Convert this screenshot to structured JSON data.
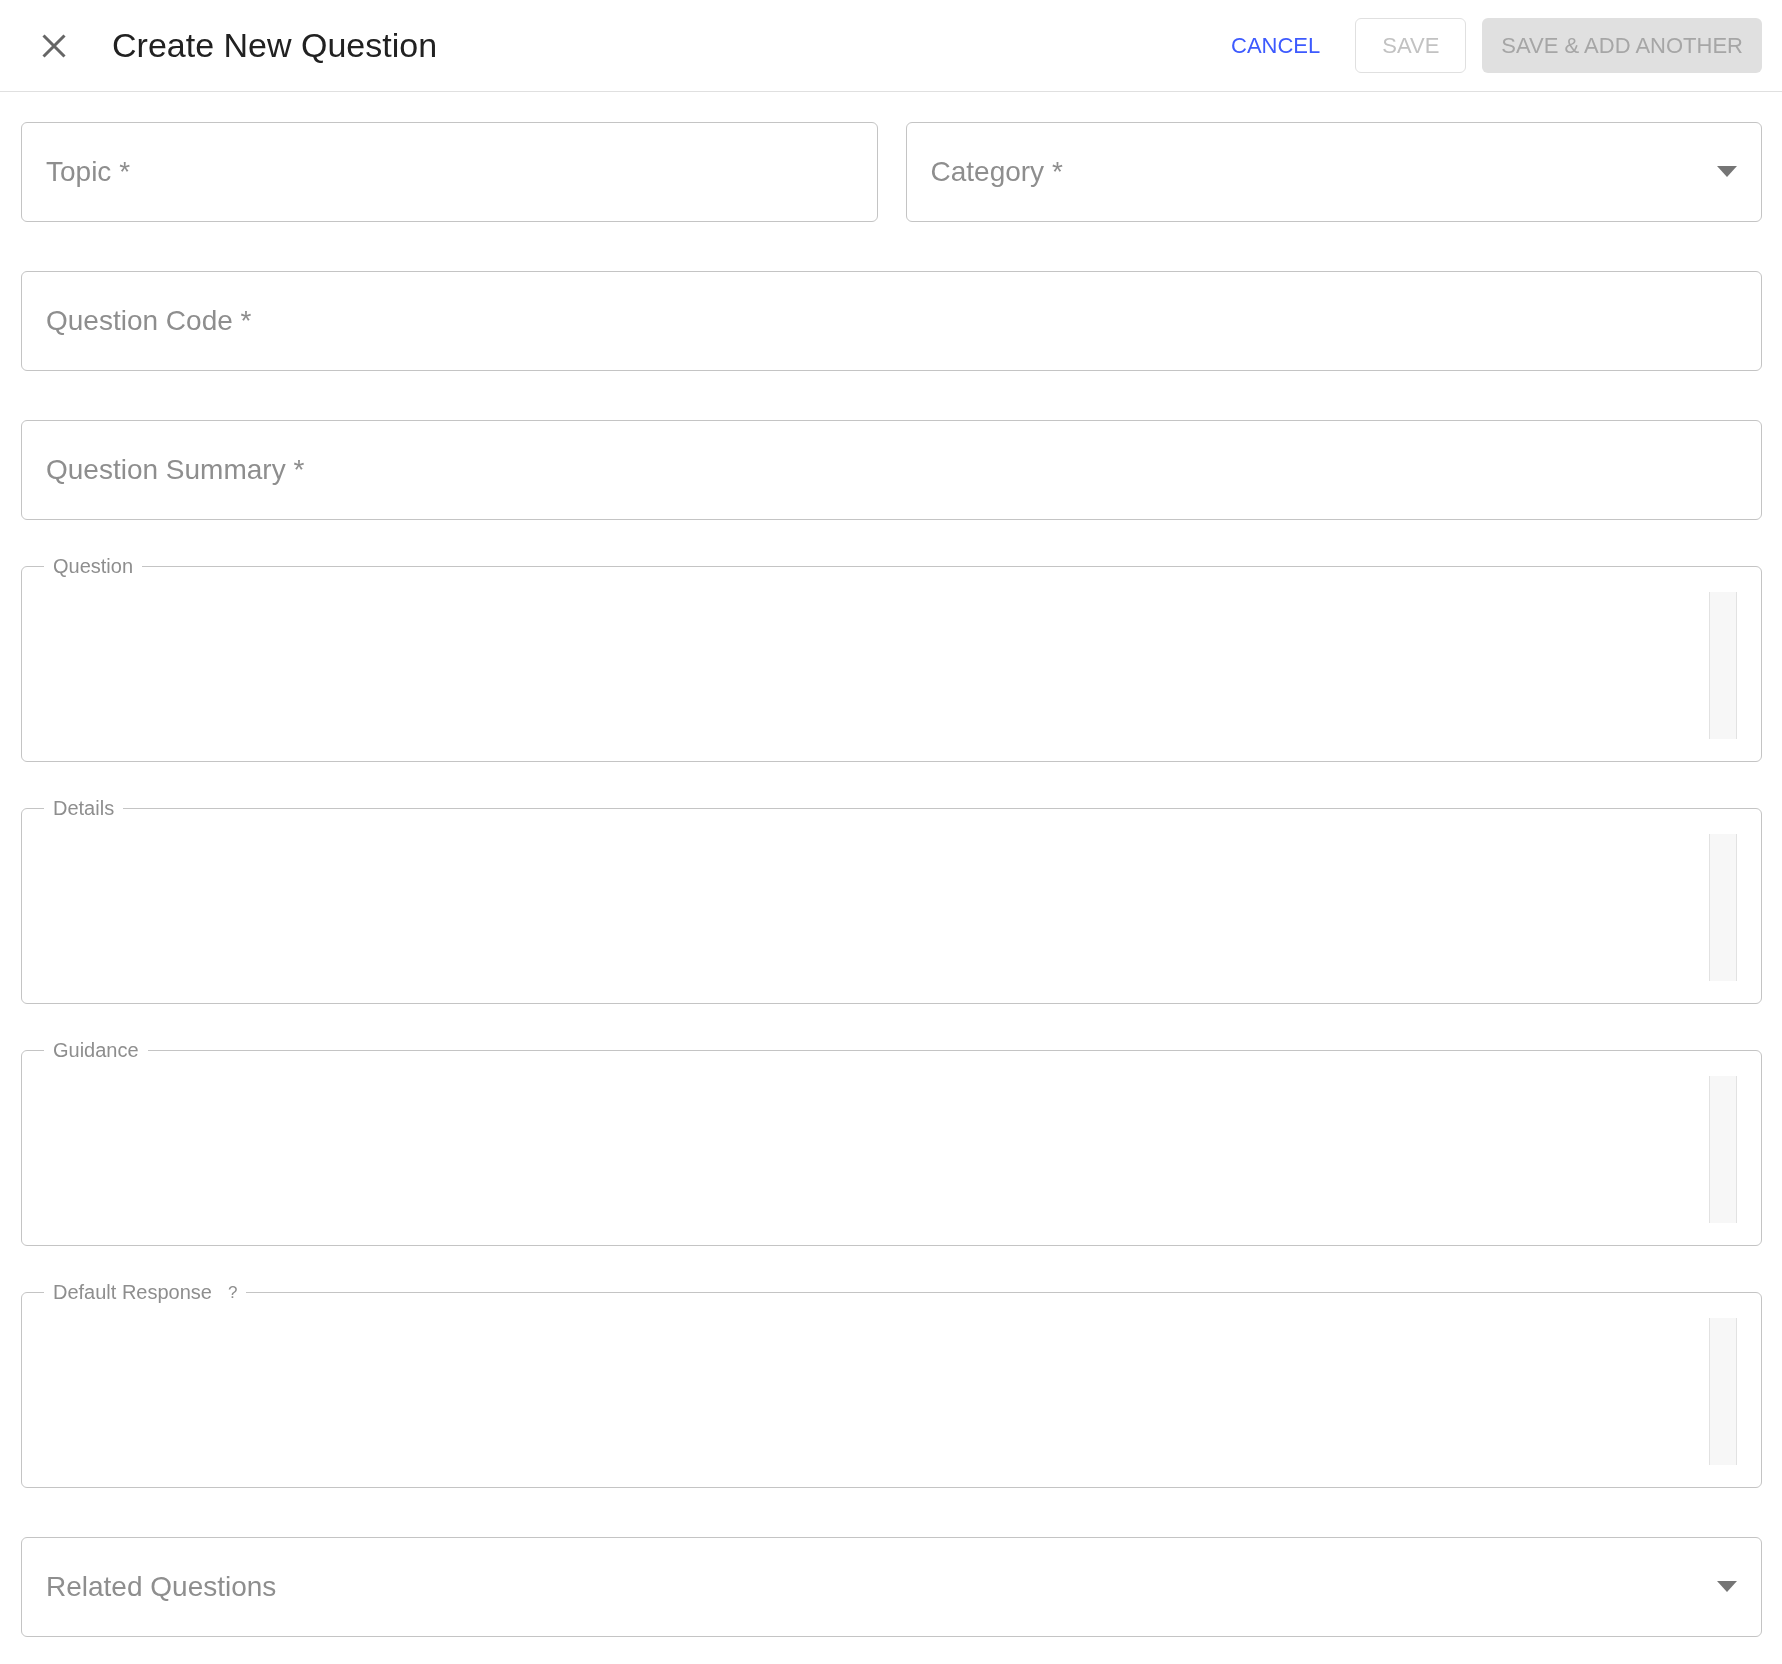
{
  "header": {
    "title": "Create New Question",
    "actions": [
      {
        "kind": "text",
        "label": "CANCEL",
        "disabled": false
      },
      {
        "kind": "outlined",
        "label": "SAVE",
        "disabled": true
      },
      {
        "kind": "contained",
        "label": "SAVE & ADD ANOTHER",
        "disabled": true
      }
    ]
  },
  "form": {
    "rows": [
      [
        {
          "kind": "text",
          "placeholder": "Topic *"
        },
        {
          "kind": "select",
          "placeholder": "Category *"
        }
      ],
      [
        {
          "kind": "text",
          "placeholder": "Question Code *"
        }
      ],
      [
        {
          "kind": "text",
          "placeholder": "Question Summary *"
        }
      ],
      [
        {
          "kind": "textarea",
          "label": "Question"
        }
      ],
      [
        {
          "kind": "textarea",
          "label": "Details"
        }
      ],
      [
        {
          "kind": "textarea",
          "label": "Guidance"
        }
      ],
      [
        {
          "kind": "textarea",
          "label": "Default Response",
          "help": "?"
        }
      ],
      [
        {
          "kind": "select",
          "placeholder": "Related Questions"
        }
      ]
    ]
  }
}
